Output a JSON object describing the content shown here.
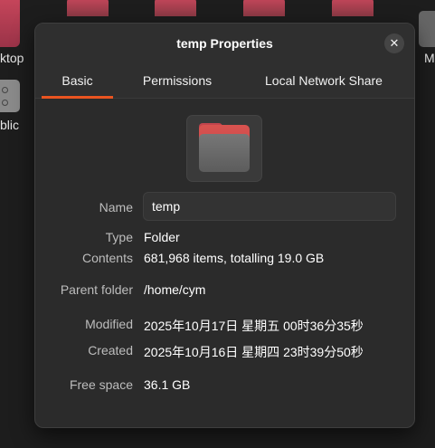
{
  "background": {
    "left_label_1": "ktop",
    "left_label_2": "blic",
    "right_label": "M"
  },
  "dialog": {
    "title": "temp Properties",
    "close_glyph": "✕",
    "tabs": [
      {
        "label": "Basic",
        "active": true
      },
      {
        "label": "Permissions",
        "active": false
      },
      {
        "label": "Local Network Share",
        "active": false
      }
    ],
    "icon": "folder-icon",
    "fields": {
      "name": {
        "label": "Name",
        "value": "temp"
      },
      "type": {
        "label": "Type",
        "value": "Folder"
      },
      "contents": {
        "label": "Contents",
        "value": "681,968 items, totalling 19.0 GB"
      },
      "parent": {
        "label": "Parent folder",
        "value": "/home/cym"
      },
      "modified": {
        "label": "Modified",
        "value": "2025年10月17日 星期五 00时36分35秒"
      },
      "created": {
        "label": "Created",
        "value": "2025年10月16日 星期四 23时39分50秒"
      },
      "free_space": {
        "label": "Free space",
        "value": "36.1 GB"
      }
    }
  },
  "colors": {
    "accent": "#e95420",
    "dialog_bg": "#2b2b2b",
    "label_text": "#bdbdbd"
  }
}
